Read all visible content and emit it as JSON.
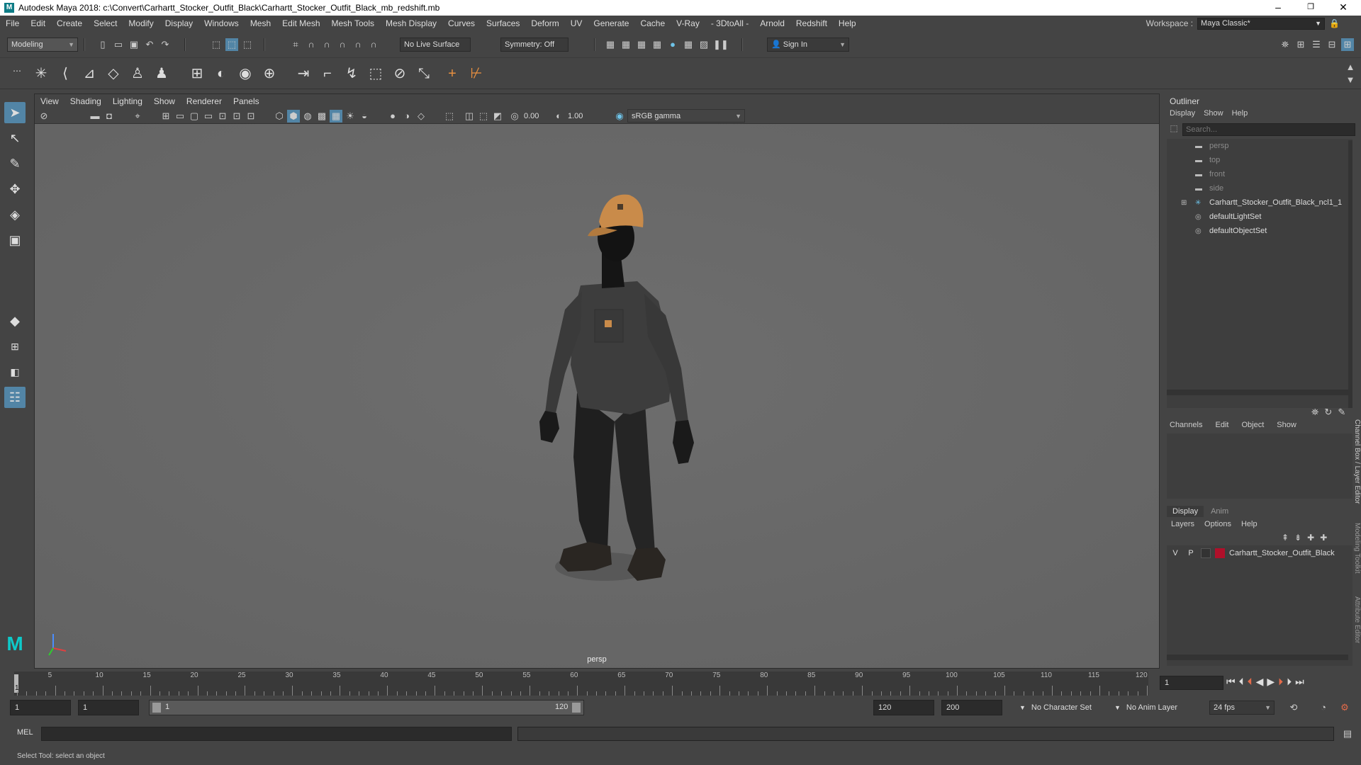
{
  "window": {
    "title": "Autodesk Maya 2018: c:\\Convert\\Carhartt_Stocker_Outfit_Black\\Carhartt_Stocker_Outfit_Black_mb_redshift.mb",
    "minimize": "–",
    "maximize": "❐",
    "close": "✕"
  },
  "menubar": {
    "items": [
      "File",
      "Edit",
      "Create",
      "Select",
      "Modify",
      "Display",
      "Windows",
      "Mesh",
      "Edit Mesh",
      "Mesh Tools",
      "Mesh Display",
      "Curves",
      "Surfaces",
      "Deform",
      "UV",
      "Generate",
      "Cache",
      "V-Ray",
      "- 3DtoAll -",
      "Arnold",
      "Redshift",
      "Help"
    ],
    "workspace_label": "Workspace :",
    "workspace_value": "Maya Classic*"
  },
  "statusline": {
    "mode": "Modeling",
    "live_surface": "No Live Surface",
    "symmetry": "Symmetry: Off",
    "sign_in": "Sign In"
  },
  "viewport": {
    "menus": [
      "View",
      "Shading",
      "Lighting",
      "Show",
      "Renderer",
      "Panels"
    ],
    "exposure": "0.00",
    "gamma": "1.00",
    "color_space": "sRGB gamma",
    "camera_label": "persp"
  },
  "outliner": {
    "title": "Outliner",
    "menus": [
      "Display",
      "Show",
      "Help"
    ],
    "search_placeholder": "Search...",
    "items": [
      {
        "label": "persp",
        "dim": true,
        "icon": "camera-icon"
      },
      {
        "label": "top",
        "dim": true,
        "icon": "camera-icon"
      },
      {
        "label": "front",
        "dim": true,
        "icon": "camera-icon"
      },
      {
        "label": "side",
        "dim": true,
        "icon": "camera-icon"
      },
      {
        "label": "Carhartt_Stocker_Outfit_Black_ncl1_1",
        "dim": false,
        "icon": "joint-icon",
        "expandable": true
      },
      {
        "label": "defaultLightSet",
        "dim": false,
        "icon": "set-icon"
      },
      {
        "label": "defaultObjectSet",
        "dim": false,
        "icon": "set-icon"
      }
    ]
  },
  "channelbox": {
    "menus": [
      "Channels",
      "Edit",
      "Object",
      "Show"
    ]
  },
  "layereditor": {
    "tabs": [
      "Display",
      "Anim"
    ],
    "menus": [
      "Layers",
      "Options",
      "Help"
    ],
    "layer": {
      "v": "V",
      "p": "P",
      "name": "Carhartt_Stocker_Outfit_Black",
      "color": "#b0102a"
    }
  },
  "side_tabs": [
    "Channel Box / Layer Editor",
    "Modeling Toolkit",
    "Attribute Editor"
  ],
  "timeslider": {
    "ticks": [
      "5",
      "10",
      "15",
      "20",
      "25",
      "30",
      "35",
      "40",
      "45",
      "50",
      "55",
      "60",
      "65",
      "70",
      "75",
      "80",
      "85",
      "90",
      "95",
      "100",
      "105",
      "110",
      "115",
      "120"
    ],
    "start_marker": "1",
    "current_frame": "1"
  },
  "rangebar": {
    "start": "1",
    "playback_start": "1",
    "range_left": "1",
    "range_right": "120",
    "playback_end": "120",
    "end": "200",
    "character_set": "No Character Set",
    "anim_layer": "No Anim Layer",
    "fps": "24 fps"
  },
  "cmdline": {
    "label": "MEL"
  },
  "helpline": {
    "text": "Select Tool: select an object"
  },
  "colors": {
    "accent": "#5285a6",
    "cap": "#c98b4a",
    "shirt": "#3c3c3c"
  }
}
